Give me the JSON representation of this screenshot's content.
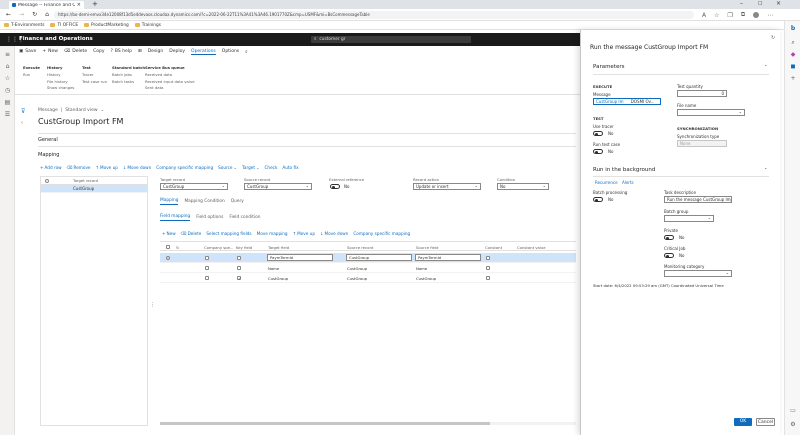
{
  "browser": {
    "tab_title": "Message -- Finance and Operati...",
    "url": "https://bo-demi-emvx34e12008f13d5e4devaos.cloudax.dynamics.com/?c=2022-06-22T11%3A41%3A46.1901770Z&cmp=USMF&mi=BsCommessageTable",
    "bookmarks": [
      "T-Environments",
      "TI OFFICE",
      "ProductMarketing",
      "Trainings"
    ]
  },
  "app": {
    "name": "Finance and Operations",
    "search_placeholder": "customer gr"
  },
  "action_pane": {
    "items": [
      "Save",
      "New",
      "Delete",
      "Copy",
      "BS help",
      "Design",
      "Deploy",
      "Operations",
      "Options"
    ],
    "selected": "Operations"
  },
  "ribbon": {
    "groups": [
      {
        "title": "Execute",
        "items": [
          "Run"
        ]
      },
      {
        "title": "History",
        "items": [
          "History",
          "File history",
          "Show changes"
        ]
      },
      {
        "title": "Test",
        "items": [
          "Tracer",
          "Test case run"
        ]
      },
      {
        "title": "Standard batch",
        "items": [
          "Batch jobs",
          "Batch tasks"
        ]
      },
      {
        "title": "Service Bus queue",
        "items": [
          "Received data",
          "Received input data value",
          "Sent data"
        ]
      }
    ]
  },
  "form": {
    "breadcrumb": [
      "Message",
      "Standard view"
    ],
    "title": "CustGroup Import FM",
    "general_label": "General",
    "mapping_label": "Mapping",
    "map_toolbar": [
      "Add row",
      "Remove",
      "Move up",
      "Move down",
      "Company specific mapping",
      "Source",
      "Target",
      "Check",
      "Auto fix"
    ],
    "left_grid": {
      "header": "Target record",
      "rows": [
        "CustGroup"
      ]
    },
    "target_record_label": "Target record",
    "target_record_value": "CustGroup",
    "source_record_label": "Source record",
    "source_record_value": "CustGroup",
    "external_reference_label": "External reference",
    "external_reference_value": "No",
    "record_action_label": "Record action",
    "record_action_value": "Update or insert",
    "condition_label": "Condition",
    "condition_value": "No",
    "subtabs": [
      "Mapping",
      "Mapping Condition",
      "Query"
    ],
    "field_tabs": [
      "Field mapping",
      "Field options",
      "Field condition"
    ],
    "field_toolbar": [
      "New",
      "Delete",
      "Select mapping fields",
      "Move mapping",
      "Move up",
      "Move down",
      "Company specific mapping"
    ],
    "field_grid": {
      "columns": [
        "Company spe...",
        "Key field",
        "Target field",
        "Source record",
        "Source field",
        "Constant",
        "Constant value"
      ],
      "rows": [
        {
          "company": false,
          "key": false,
          "target": "PaymTermId",
          "source_record": "CustGroup",
          "source_field": "PaymTermId",
          "constant": false,
          "value": ""
        },
        {
          "company": false,
          "key": false,
          "target": "Name",
          "source_record": "CustGroup",
          "source_field": "Name",
          "constant": false,
          "value": ""
        },
        {
          "company": false,
          "key": true,
          "target": "CustGroup",
          "source_record": "CustGroup",
          "source_field": "CustGroup",
          "constant": false,
          "value": ""
        }
      ]
    }
  },
  "dialog": {
    "title": "Run the message CustGroup Import FM",
    "parameters_label": "Parameters",
    "execute_label": "EXECUTE",
    "message_label": "Message",
    "message_value": "CustGroup Im",
    "message_value2": "DOSMI Ov...",
    "test_quantity_label": "Test quantity",
    "test_quantity_value": "0",
    "file_name_label": "File name",
    "test_label": "TEST",
    "use_tracer_label": "Use tracer",
    "use_tracer_value": "No",
    "run_test_case_label": "Run test case",
    "run_test_case_value": "No",
    "sync_label": "SYNCHRONIZATION",
    "sync_type_label": "Synchronization type",
    "sync_type_value": "None",
    "background_label": "Run in the background",
    "recurrence_label": "Recurrence",
    "alerts_label": "Alerts",
    "batch_processing_label": "Batch processing",
    "batch_processing_value": "No",
    "task_description_label": "Task description",
    "task_description_value": "Run the message CustGroup Imp...",
    "batch_group_label": "Batch group",
    "private_label": "Private",
    "private_value": "No",
    "critical_job_label": "Critical Job",
    "critical_job_value": "No",
    "monitoring_label": "Monitoring category",
    "start_date_text": "Start date: 6/4/2022 09:53:29 am (GMT) Coordinated Universal Time",
    "ok_label": "OK",
    "cancel_label": "Cancel"
  },
  "colors": {
    "accent": "#0f6cbd",
    "appbar": "#1a1a1a"
  }
}
